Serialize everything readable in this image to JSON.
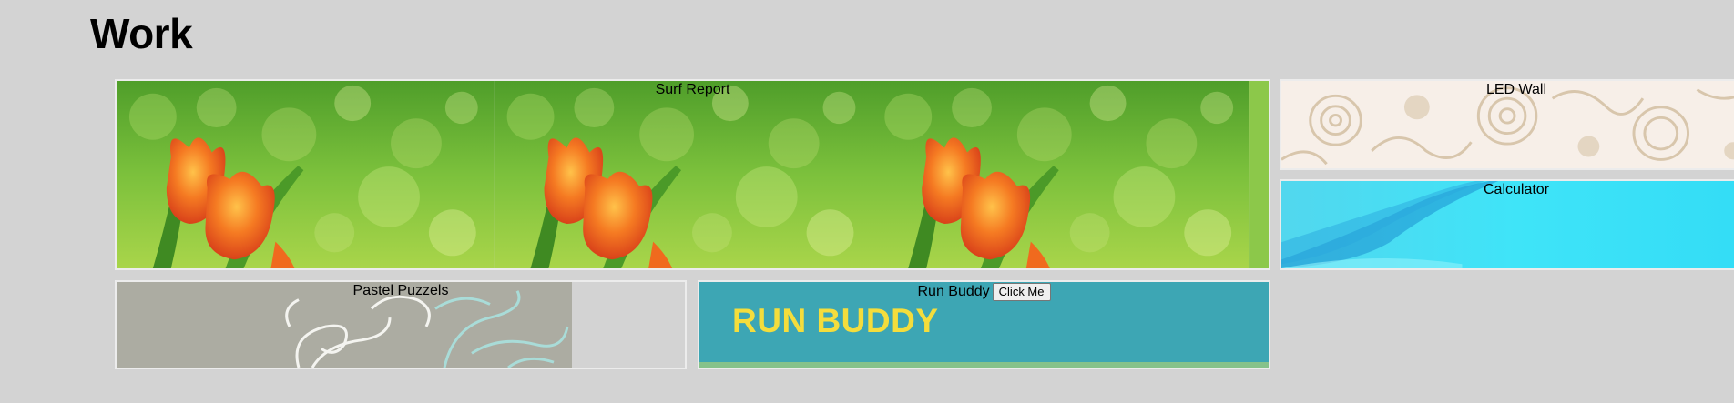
{
  "page": {
    "heading": "Work"
  },
  "projects": {
    "surf": {
      "title": "Surf Report"
    },
    "led": {
      "title": "LED Wall"
    },
    "calc": {
      "title": "Calculator"
    },
    "pastel": {
      "title": "Pastel Puzzels"
    },
    "run": {
      "title": "Run Buddy",
      "button_label": "Click Me",
      "logo_text": "RUN BUDDY"
    }
  },
  "colors": {
    "page_bg": "#d3d3d3",
    "surf_green": "#6cba3a",
    "tulip_orange": "#f06a1e",
    "led_bg": "#f7efe8",
    "calc_cyan": "#35e1f7",
    "pastel_gray": "#acaca2",
    "run_teal": "#3da6b4",
    "run_yellow": "#f4dd3c"
  }
}
